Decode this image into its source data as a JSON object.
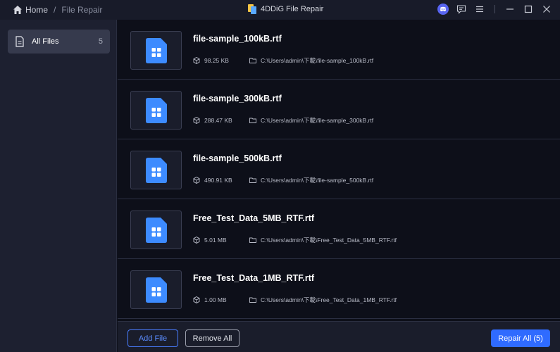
{
  "breadcrumb": {
    "home": "Home",
    "separator": "/",
    "current": "File Repair"
  },
  "app": {
    "title": "4DDiG File Repair"
  },
  "window_controls": [
    "discord-icon",
    "feedback-icon",
    "menu-icon",
    "minimize-icon",
    "maximize-icon",
    "close-icon"
  ],
  "sidebar": {
    "items": [
      {
        "label": "All Files",
        "count": "5",
        "icon": "file-icon"
      }
    ]
  },
  "files": [
    {
      "name": "file-sample_100kB.rtf",
      "size": "98.25 KB",
      "path": "C:\\Users\\admin\\下載\\file-sample_100kB.rtf"
    },
    {
      "name": "file-sample_300kB.rtf",
      "size": "288.47 KB",
      "path": "C:\\Users\\admin\\下載\\file-sample_300kB.rtf"
    },
    {
      "name": "file-sample_500kB.rtf",
      "size": "490.91 KB",
      "path": "C:\\Users\\admin\\下載\\file-sample_500kB.rtf"
    },
    {
      "name": "Free_Test_Data_5MB_RTF.rtf",
      "size": "5.01 MB",
      "path": "C:\\Users\\admin\\下載\\Free_Test_Data_5MB_RTF.rtf"
    },
    {
      "name": "Free_Test_Data_1MB_RTF.rtf",
      "size": "1.00 MB",
      "path": "C:\\Users\\admin\\下載\\Free_Test_Data_1MB_RTF.rtf"
    }
  ],
  "footer": {
    "add_label": "Add File",
    "remove_label": "Remove All",
    "repair_label": "Repair All (5)"
  },
  "colors": {
    "accent": "#2f6bff",
    "file_icon": "#3d8bff",
    "background": "#0d0f19"
  }
}
